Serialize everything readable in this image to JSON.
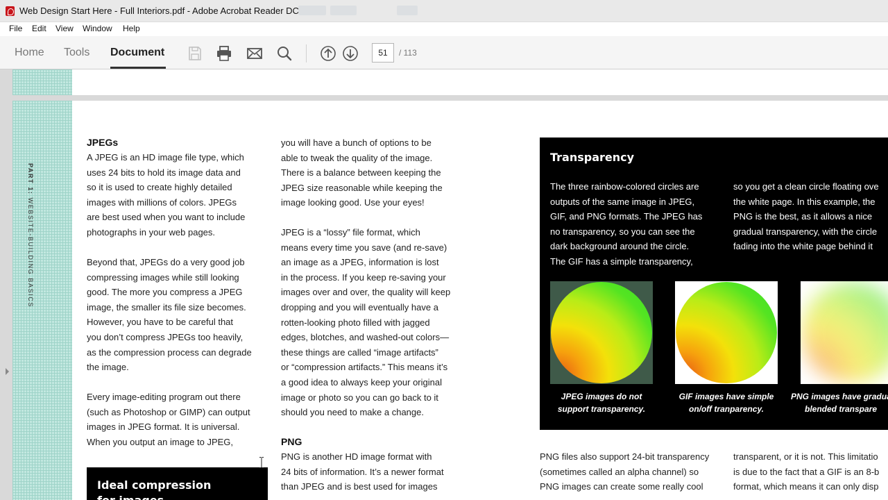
{
  "window": {
    "title": "Web Design Start Here - Full Interiors.pdf - Adobe Acrobat Reader DC"
  },
  "menu": [
    "File",
    "Edit",
    "View",
    "Window",
    "Help"
  ],
  "toolbar": {
    "tabs": [
      "Home",
      "Tools",
      "Document"
    ],
    "active_tab": "Document",
    "current_page": "51",
    "total_pages": "/ 113",
    "icons": [
      "save-icon",
      "print-icon",
      "email-icon",
      "search-icon",
      "page-up-icon",
      "page-down-icon"
    ]
  },
  "page": {
    "side_label_bold": "PART 1:",
    "side_label": "WEBSITE-BUILDING BASICS",
    "col1": {
      "heading": "JPEGs",
      "p1": [
        "A JPEG is an HD image file type, which",
        "uses 24 bits to hold its image data and",
        "so it is used to create highly detailed",
        "images with millions of colors. JPEGs",
        "are best used when you want to include",
        "photographs in your web pages."
      ],
      "p2": [
        "Beyond that, JPEGs do a very good job",
        "compressing images while still looking",
        "good. The more you compress a JPEG",
        "image, the smaller its file size becomes.",
        "However, you have to be careful that",
        "you don’t compress JPEGs too heavily,",
        "as the compression process can degrade",
        "the image."
      ],
      "p3": [
        "Every image-editing program out there",
        "(such as Photoshop or GIMP) can output",
        "images in JPEG format. It is universal.",
        "When you output an image to JPEG,"
      ],
      "box_title": "Ideal compression",
      "box_title_2": "for images"
    },
    "col2": {
      "p1": [
        "you will have a bunch of options to be",
        "able to tweak the quality of the image.",
        "There is a balance between keeping the",
        "JPEG size reasonable while keeping the",
        "image looking good. Use your eyes!"
      ],
      "p2": [
        "JPEG is a “lossy” file format, which",
        "means every time you save (and re-save)",
        "an image as a JPEG, information is lost",
        "in the process. If you keep re-saving your",
        "images over and over, the quality will keep",
        "dropping and you will eventually have a",
        "rotten-looking photo filled with jagged",
        "edges, blotches, and washed-out colors—",
        "these things are called “image artifacts”",
        "or “compression artifacts.” This means it’s",
        "a good idea to always keep your original",
        "image or photo so you can go back to it",
        "should you need to make a change."
      ],
      "heading": "PNG",
      "p3": [
        "PNG is another HD image format with",
        "24 bits of information. It’s a newer format",
        "than JPEG and is best used for images"
      ]
    },
    "transparency": {
      "title": "Transparency",
      "left": [
        "The three rainbow-colored circles are",
        "outputs of the same image in JPEG,",
        "GIF, and PNG formats. The JPEG has",
        "no transparency, so you can see the",
        "dark background around the circle.",
        "The GIF has a simple transparency,"
      ],
      "right": [
        "so you get a clean circle floating ove",
        "the white page. In this example, the",
        "PNG is the best, as it allows a nice",
        "gradual transparency, with the circle",
        "fading into the white page behind it"
      ],
      "captions": [
        [
          "JPEG images do not",
          "support transparency."
        ],
        [
          "GIF images have simple",
          "on/off tranparency."
        ],
        [
          "PNG images have gradua",
          "blended transpare"
        ]
      ]
    },
    "col3": {
      "left": [
        "PNG files also support 24-bit transparency",
        "(sometimes called an alpha channel) so",
        "PNG images can create some really cool"
      ],
      "right": [
        "transparent, or it is not. This limitatio",
        "is due to the fact that a GIF is an 8-b",
        "format, which means it can only disp"
      ]
    }
  }
}
